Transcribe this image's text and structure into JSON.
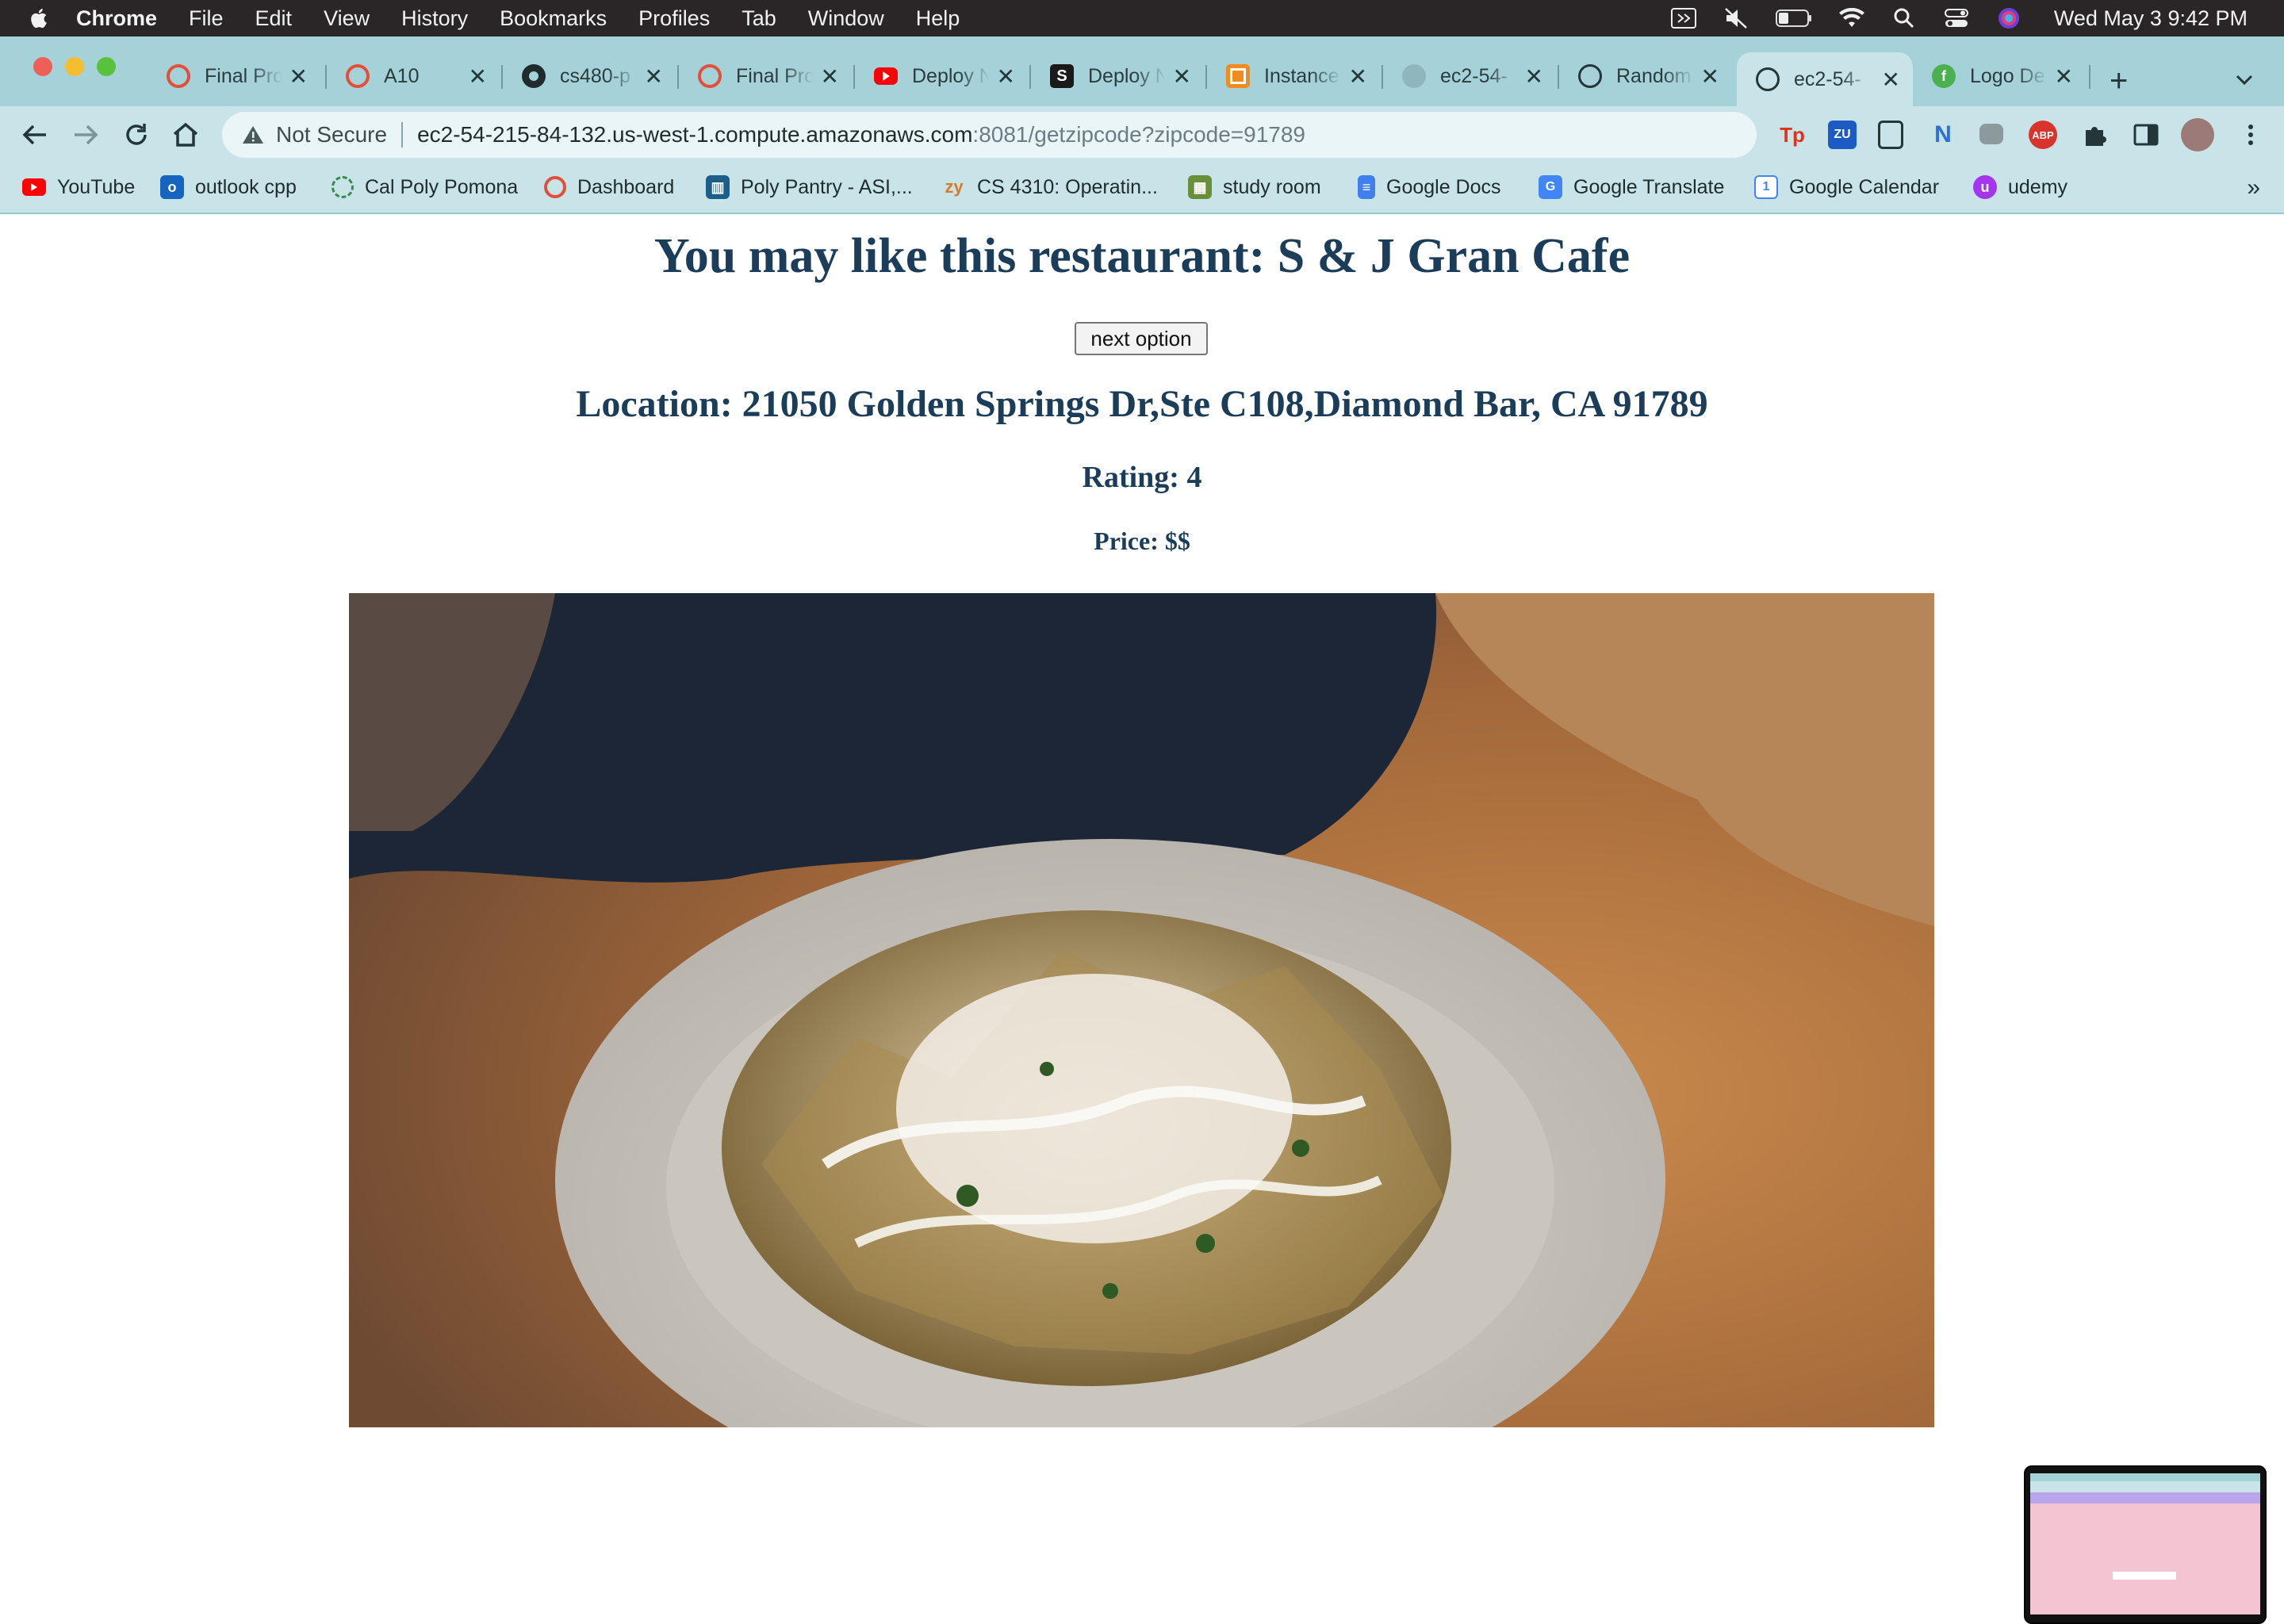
{
  "menubar": {
    "app_name": "Chrome",
    "menus": [
      "File",
      "Edit",
      "View",
      "History",
      "Bookmarks",
      "Profiles",
      "Tab",
      "Window",
      "Help"
    ],
    "clock": "Wed May 3  9:42 PM"
  },
  "tabs": [
    {
      "title": "Final Pro",
      "icon": "canvas-icon"
    },
    {
      "title": "A10",
      "icon": "canvas-icon"
    },
    {
      "title": "cs480-p",
      "icon": "github-icon"
    },
    {
      "title": "Final Pro",
      "icon": "canvas-icon"
    },
    {
      "title": "Deploy N",
      "icon": "youtube-icon"
    },
    {
      "title": "Deploy N",
      "icon": "s-icon"
    },
    {
      "title": "Instance",
      "icon": "aws-icon"
    },
    {
      "title": "ec2-54-",
      "icon": "loading-icon"
    },
    {
      "title": "Random",
      "icon": "globe-icon"
    },
    {
      "title": "ec2-54-",
      "icon": "globe-icon",
      "active": true
    },
    {
      "title": "Logo De",
      "icon": "logo-icon"
    }
  ],
  "omnibox": {
    "security": "Not Secure",
    "host": "ec2-54-215-84-132.us-west-1.compute.amazonaws.com",
    "path": ":8081/getzipcode?zipcode=91789"
  },
  "bookmarks": [
    {
      "label": "YouTube",
      "icon": "youtube-icon"
    },
    {
      "label": "outlook cpp",
      "icon": "outlook-icon"
    },
    {
      "label": "Cal Poly Pomona",
      "icon": "circle-icon"
    },
    {
      "label": "Dashboard",
      "icon": "canvas-icon"
    },
    {
      "label": "Poly Pantry - ASI,...",
      "icon": "asi-icon"
    },
    {
      "label": "CS 4310: Operatin...",
      "icon": "zy-icon"
    },
    {
      "label": "study room",
      "icon": "room-icon"
    },
    {
      "label": "Google Docs",
      "icon": "docs-icon"
    },
    {
      "label": "Google Translate",
      "icon": "translate-icon"
    },
    {
      "label": "Google Calendar",
      "icon": "calendar-icon"
    },
    {
      "label": "udemy",
      "icon": "udemy-icon"
    }
  ],
  "page": {
    "heading": "You may like this restaurant: S & J Gran Cafe",
    "next_button": "next option",
    "location": "Location: 21050 Golden Springs Dr,Ste C108,Diamond Bar, CA 91789",
    "rating": "Rating: 4",
    "price": "Price: $$"
  },
  "extensions": {
    "tp_label": "Tp",
    "zu_label": "ZU",
    "abp_label": "ABP"
  },
  "colors": {
    "tab_strip": "#a5d2d9",
    "toolbar": "#c8e4e8",
    "heading_text": "#1b3d5a"
  }
}
